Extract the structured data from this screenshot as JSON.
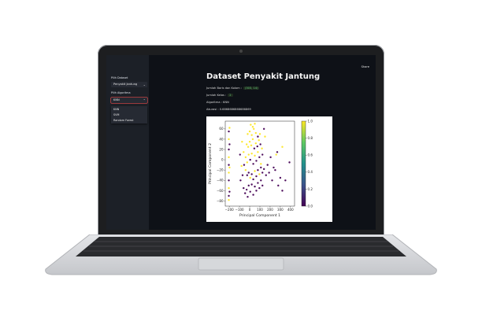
{
  "header": {
    "share_label": "Share"
  },
  "sidebar": {
    "dataset_label": "Pilih Dataset",
    "dataset_value": "Penyakit Jantung",
    "algorithm_label": "Pilih Algoritma",
    "algorithm_value": "KNN",
    "algorithm_options": [
      "KNN",
      "SVM",
      "Random Forest"
    ]
  },
  "main": {
    "title": "Dataset Penyakit Jantung",
    "rows_cols_label": "Jumlah Baris dan Kolom :",
    "rows_cols_value": "(303, 14)",
    "classes_label": "Jumlah Kelas :",
    "classes_value": "2",
    "algorithm_text": "Algoritma : KNN",
    "accuracy_text": "Akurasi : 0.6868686868686869"
  },
  "chart_data": {
    "type": "scatter",
    "xlabel": "Principal Component 1",
    "ylabel": "Principal Component 2",
    "xlim": [
      -240,
      440
    ],
    "ylim": [
      -90,
      75
    ],
    "x_ticks": [
      -200,
      -100,
      0,
      100,
      200,
      300,
      400
    ],
    "y_ticks": [
      -80,
      -60,
      -40,
      -20,
      0,
      20,
      40,
      60
    ],
    "colorbar": {
      "cmap": "viridis",
      "range": [
        0.0,
        1.0
      ],
      "ticks": [
        0.0,
        0.2,
        0.4,
        0.6,
        0.8,
        1.0
      ]
    },
    "points": [
      [
        -205,
        55,
        0
      ],
      [
        -205,
        40,
        1
      ],
      [
        -205,
        20,
        0
      ],
      [
        -205,
        5,
        1
      ],
      [
        -205,
        -10,
        0
      ],
      [
        -205,
        -25,
        1
      ],
      [
        -205,
        -40,
        0
      ],
      [
        -205,
        -55,
        1
      ],
      [
        -205,
        -70,
        0
      ],
      [
        -205,
        -78,
        1
      ],
      [
        -198,
        62,
        1
      ],
      [
        -198,
        30,
        0
      ],
      [
        -198,
        -15,
        1
      ],
      [
        -198,
        -62,
        0
      ],
      [
        -90,
        -40,
        0
      ],
      [
        -60,
        -55,
        0
      ],
      [
        -45,
        -65,
        0
      ],
      [
        -30,
        -58,
        0
      ],
      [
        -20,
        -72,
        0
      ],
      [
        -10,
        -50,
        0
      ],
      [
        5,
        -62,
        0
      ],
      [
        20,
        -48,
        0
      ],
      [
        35,
        -68,
        0
      ],
      [
        50,
        -52,
        0
      ],
      [
        65,
        -60,
        0
      ],
      [
        80,
        -45,
        0
      ],
      [
        95,
        -55,
        0
      ],
      [
        110,
        -40,
        0
      ],
      [
        125,
        -50,
        0
      ],
      [
        -40,
        -20,
        1
      ],
      [
        -25,
        -30,
        0
      ],
      [
        -10,
        -25,
        0
      ],
      [
        5,
        -35,
        1
      ],
      [
        20,
        -28,
        0
      ],
      [
        35,
        -38,
        0
      ],
      [
        50,
        -22,
        1
      ],
      [
        65,
        -32,
        0
      ],
      [
        80,
        -20,
        0
      ],
      [
        95,
        -28,
        1
      ],
      [
        110,
        -15,
        0
      ],
      [
        125,
        -25,
        0
      ],
      [
        140,
        -18,
        0
      ],
      [
        -40,
        5,
        1
      ],
      [
        -25,
        -5,
        1
      ],
      [
        -10,
        10,
        1
      ],
      [
        5,
        0,
        0
      ],
      [
        20,
        12,
        1
      ],
      [
        35,
        -8,
        0
      ],
      [
        50,
        8,
        1
      ],
      [
        65,
        -2,
        0
      ],
      [
        80,
        15,
        1
      ],
      [
        95,
        5,
        0
      ],
      [
        110,
        -8,
        1
      ],
      [
        125,
        10,
        0
      ],
      [
        -30,
        30,
        1
      ],
      [
        -15,
        25,
        1
      ],
      [
        0,
        35,
        1
      ],
      [
        15,
        28,
        1
      ],
      [
        30,
        40,
        1
      ],
      [
        45,
        22,
        0
      ],
      [
        60,
        32,
        1
      ],
      [
        75,
        26,
        0
      ],
      [
        90,
        38,
        1
      ],
      [
        105,
        30,
        0
      ],
      [
        120,
        22,
        1
      ],
      [
        -20,
        50,
        1
      ],
      [
        0,
        55,
        1
      ],
      [
        20,
        48,
        1
      ],
      [
        40,
        60,
        1
      ],
      [
        60,
        52,
        1
      ],
      [
        80,
        45,
        0
      ],
      [
        100,
        50,
        1
      ],
      [
        10,
        68,
        1
      ],
      [
        30,
        64,
        1
      ],
      [
        50,
        70,
        1
      ],
      [
        -55,
        -10,
        0
      ],
      [
        -60,
        15,
        1
      ],
      [
        -70,
        -30,
        0
      ],
      [
        -75,
        35,
        1
      ],
      [
        160,
        -30,
        0
      ],
      [
        175,
        -10,
        0
      ],
      [
        190,
        -25,
        0
      ],
      [
        205,
        5,
        0
      ],
      [
        220,
        -40,
        0
      ],
      [
        235,
        -15,
        0
      ],
      [
        250,
        -20,
        0
      ],
      [
        280,
        -50,
        0
      ],
      [
        300,
        -35,
        0
      ],
      [
        260,
        10,
        1
      ],
      [
        320,
        -60,
        0
      ],
      [
        270,
        15,
        0
      ],
      [
        320,
        25,
        1
      ],
      [
        390,
        -5,
        0
      ],
      [
        350,
        -40,
        0
      ],
      [
        -95,
        10,
        0
      ],
      [
        -80,
        -12,
        1
      ],
      [
        150,
        45,
        1
      ],
      [
        140,
        60,
        0
      ]
    ]
  }
}
